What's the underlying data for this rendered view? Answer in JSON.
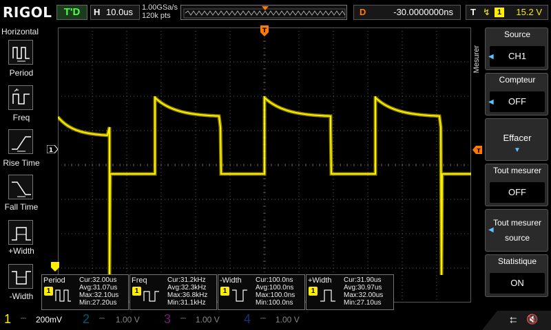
{
  "top": {
    "brand": "RIGOL",
    "trigger_status": "T'D",
    "horiz_key": "H",
    "timebase": "10.0us",
    "sample_rate": "1.00GSa/s",
    "memory_depth": "120k pts",
    "delay_key": "D",
    "delay": "-30.0000000ns",
    "trig_key": "T",
    "trig_edge": "rising-edge-icon",
    "trig_source": "1",
    "trig_level": "15.2 V"
  },
  "left": {
    "title": "Horizontal",
    "items": [
      {
        "label": "Period",
        "icon": "period-icon"
      },
      {
        "label": "Freq",
        "icon": "freq-icon"
      },
      {
        "label": "Rise Time",
        "icon": "rise-time-icon"
      },
      {
        "label": "Fall Time",
        "icon": "fall-time-icon"
      },
      {
        "label": "+Width",
        "icon": "plus-width-icon"
      },
      {
        "label": "-Width",
        "icon": "minus-width-icon"
      }
    ]
  },
  "right": {
    "title": "Mesurer",
    "source_label": "Source",
    "source_value": "CH1",
    "compteur_label": "Compteur",
    "compteur_value": "OFF",
    "effacer_label": "Effacer",
    "tout_label": "Tout mesurer",
    "tout_value": "OFF",
    "tout_source_label": "Tout mesurer",
    "tout_source_sub": "source",
    "stat_label": "Statistique",
    "stat_value": "ON"
  },
  "markers": {
    "ch1_ground": "1",
    "trigger_pos": "T"
  },
  "measurements": [
    {
      "name": "Period",
      "ch": "1",
      "cur": "Cur:32.00us",
      "avg": "Avg:31.07us",
      "max": "Max:32.10us",
      "min": "Min:27.20us"
    },
    {
      "name": "Freq",
      "ch": "1",
      "cur": "Cur:31.2kHz",
      "avg": "Avg:32.3kHz",
      "max": "Max:36.8kHz",
      "min": "Min:31.1kHz"
    },
    {
      "name": "-Width",
      "ch": "1",
      "cur": "Cur:100.0ns",
      "avg": "Avg:100.0ns",
      "max": "Max:100.0ns",
      "min": "Min:100.0ns"
    },
    {
      "name": "+Width",
      "ch": "1",
      "cur": "Cur:31.90us",
      "avg": "Avg:30.97us",
      "max": "Max:32.00us",
      "min": "Min:27.10us"
    }
  ],
  "bottom": {
    "channels": [
      {
        "num": "1",
        "scale": "200mV",
        "color": "#ffee00"
      },
      {
        "num": "2",
        "scale": "1.00 V",
        "color": "#00c8ff"
      },
      {
        "num": "3",
        "scale": "1.00 V",
        "color": "#ff40ff"
      },
      {
        "num": "4",
        "scale": "1.00 V",
        "color": "#3070ff"
      }
    ],
    "usb": "usb-icon",
    "speaker": "speaker-muted-icon"
  },
  "colors": {
    "trace": "#ffee00",
    "accent": "#ff7a00",
    "grid": "#5a5a5a"
  }
}
